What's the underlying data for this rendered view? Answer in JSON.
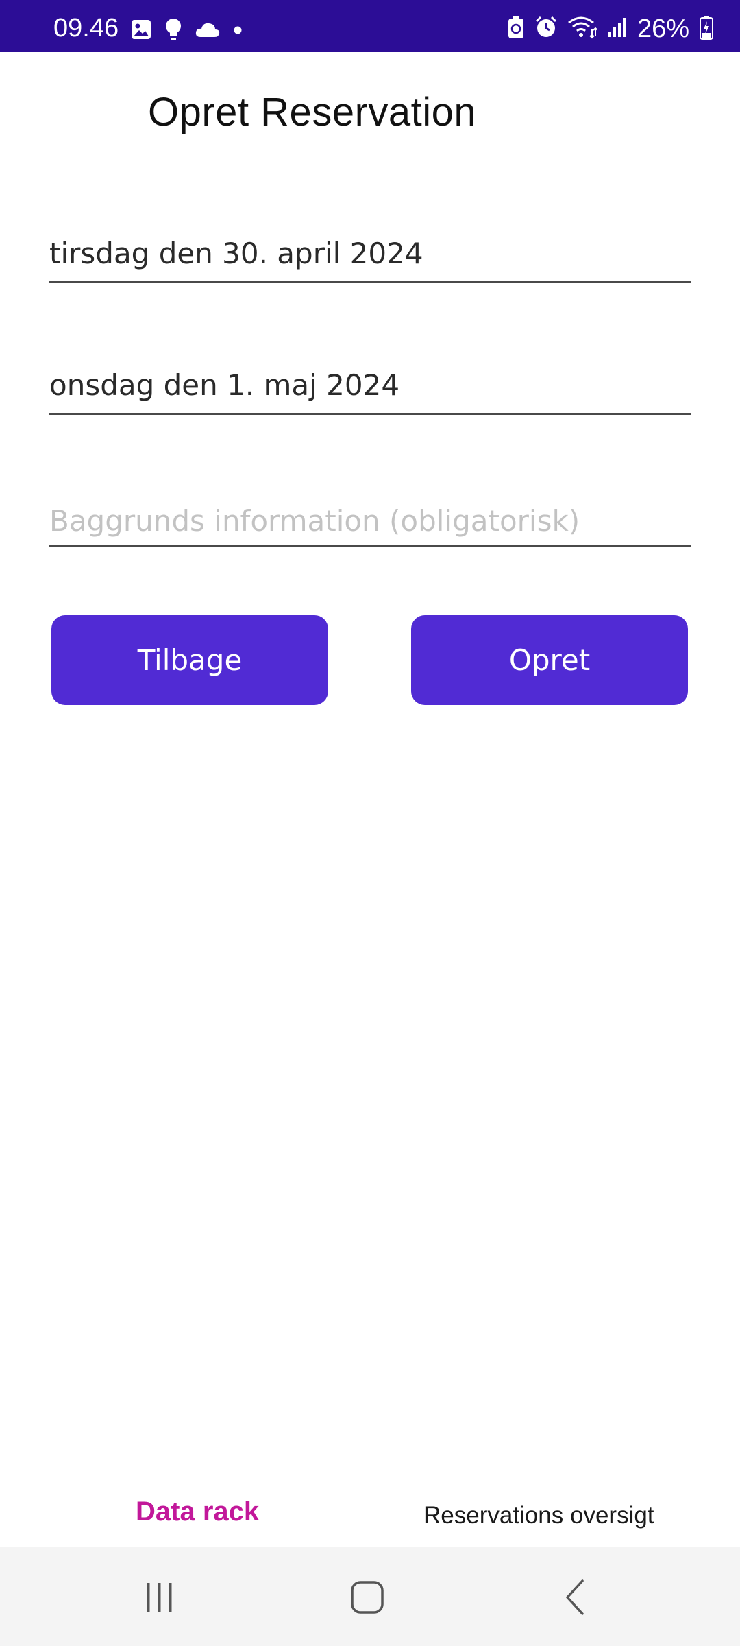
{
  "status_bar": {
    "time": "09.46",
    "battery": "26%",
    "left_icons": [
      "image-icon",
      "lightbulb-icon",
      "cloud-icon",
      "dot-icon"
    ],
    "right_icons": [
      "recycle-battery-icon",
      "alarm-icon",
      "wifi-icon",
      "signal-icon",
      "battery-charging-icon"
    ]
  },
  "page": {
    "title": "Opret Reservation"
  },
  "form": {
    "start_date": "tirsdag den 30. april 2024",
    "end_date": "onsdag den 1. maj 2024",
    "background_info": {
      "value": "",
      "placeholder": "Baggrunds information (obligatorisk)"
    }
  },
  "buttons": {
    "back_label": "Tilbage",
    "create_label": "Opret"
  },
  "tabs": [
    {
      "label": "Data rack",
      "active": true
    },
    {
      "label": "Reservations oversigt",
      "active": false
    }
  ],
  "nav": {
    "buttons": [
      "recent-apps-icon",
      "home-icon",
      "back-icon"
    ]
  },
  "colors": {
    "status_bar": "#2c0d96",
    "button": "#512bd4",
    "active_tab": "#c2189a"
  }
}
